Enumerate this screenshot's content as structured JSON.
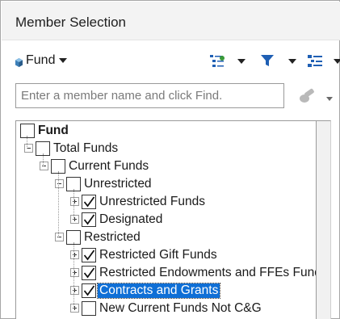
{
  "panel": {
    "title": "Member Selection"
  },
  "toolbar": {
    "dimension_label": "Fund",
    "icons": [
      "member-list-icon",
      "filter-icon",
      "hierarchy-view-icon"
    ]
  },
  "search": {
    "placeholder": "Enter a member name and click Find.",
    "value": ""
  },
  "tree": {
    "items": [
      {
        "label": "Fund",
        "bold": true,
        "checked": false,
        "expander": null,
        "level": 0
      },
      {
        "label": "Total Funds",
        "checked": false,
        "expander": "minus",
        "level": 1
      },
      {
        "label": "Current Funds",
        "checked": false,
        "expander": "minus",
        "level": 2
      },
      {
        "label": "Unrestricted",
        "checked": false,
        "expander": "minus",
        "level": 3
      },
      {
        "label": "Unrestricted Funds",
        "checked": true,
        "expander": "plus",
        "level": 4
      },
      {
        "label": "Designated",
        "checked": true,
        "expander": "plus",
        "level": 4
      },
      {
        "label": "Restricted",
        "checked": false,
        "expander": "minus",
        "level": 3
      },
      {
        "label": "Restricted Gift Funds",
        "checked": true,
        "expander": "plus",
        "level": 4
      },
      {
        "label": "Restricted Endowments and FFEs Funds",
        "checked": true,
        "expander": "plus",
        "level": 4
      },
      {
        "label": "Contracts and Grants",
        "checked": true,
        "expander": "plus",
        "level": 4,
        "selected": true
      },
      {
        "label": "New Current Funds Not C&G",
        "checked": false,
        "expander": "plus",
        "level": 4
      }
    ]
  },
  "colors": {
    "accent": "#0f6fd6",
    "icon_blue": "#1f5fb4",
    "icon_green": "#3a9a3a"
  }
}
